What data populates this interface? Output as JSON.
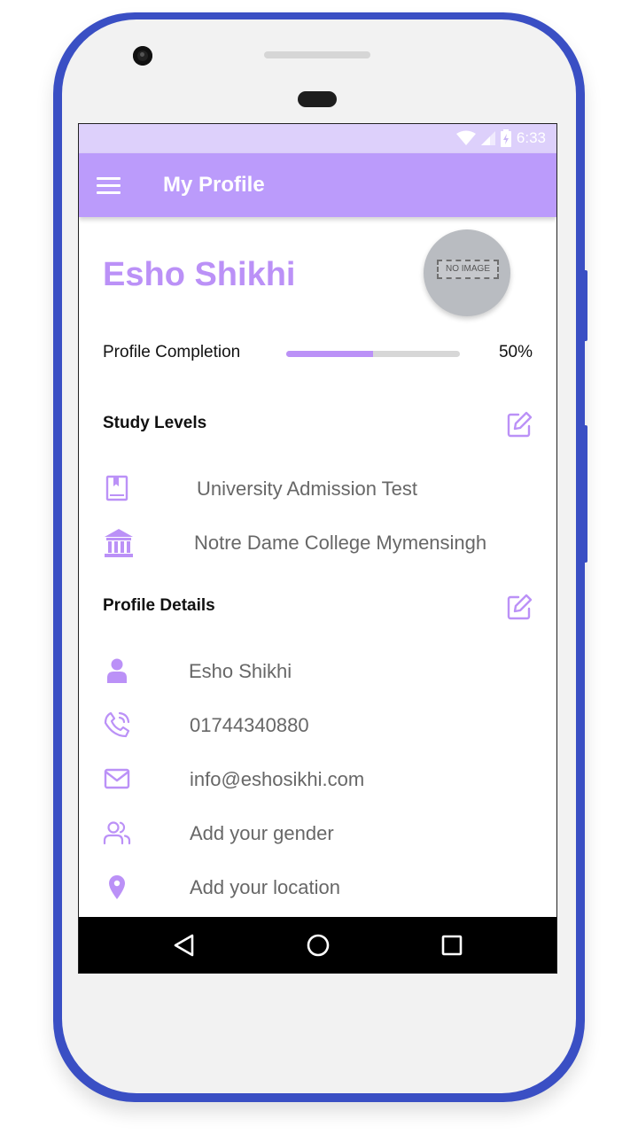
{
  "status_bar": {
    "time": "6:33"
  },
  "app_bar": {
    "title": "My Profile"
  },
  "profile": {
    "name": "Esho Shikhi",
    "avatar_placeholder": "NO IMAGE",
    "completion_label": "Profile Completion",
    "completion_value": "50%",
    "completion_fraction": 0.5
  },
  "study_levels": {
    "title": "Study Levels",
    "items": [
      {
        "icon": "book-icon",
        "text": "University Admission Test"
      },
      {
        "icon": "institution-icon",
        "text": "Notre Dame College Mymensingh"
      }
    ]
  },
  "profile_details": {
    "title": "Profile Details",
    "items": [
      {
        "icon": "person-icon",
        "text": "Esho Shikhi"
      },
      {
        "icon": "phone-icon",
        "text": "01744340880"
      },
      {
        "icon": "email-icon",
        "text": "info@eshosikhi.com"
      },
      {
        "icon": "people-icon",
        "text": "Add your gender"
      },
      {
        "icon": "location-icon",
        "text": "Add your location"
      }
    ]
  },
  "colors": {
    "accent": "#bb91f7",
    "app_bar": "#bb9bfb",
    "status_bar": "#ddd0fb",
    "phone_frame": "#3a4fc4"
  }
}
